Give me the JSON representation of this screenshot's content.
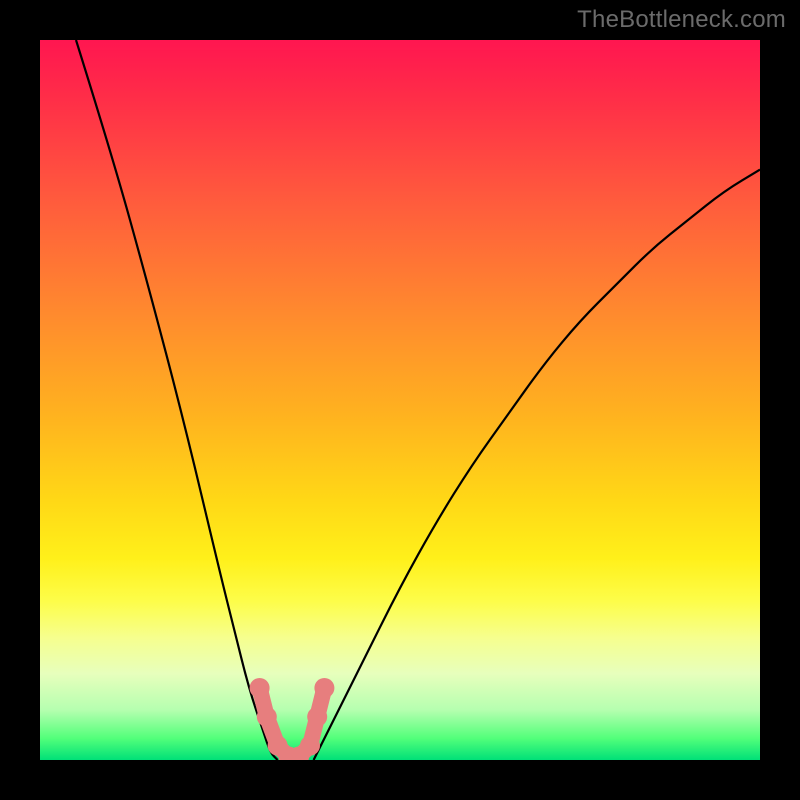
{
  "watermark": "TheBottleneck.com",
  "colors": {
    "black": "#000000",
    "dot": "#e77e7e"
  },
  "chart_data": {
    "type": "line",
    "title": "",
    "xlabel": "",
    "ylabel": "",
    "xlim": [
      0,
      100
    ],
    "ylim": [
      0,
      100
    ],
    "series": [
      {
        "name": "left-branch",
        "x": [
          5,
          10,
          15,
          20,
          25,
          27,
          29,
          31,
          32,
          33
        ],
        "y": [
          100,
          84,
          66,
          47,
          26,
          18,
          10,
          4,
          1,
          0
        ]
      },
      {
        "name": "right-branch",
        "x": [
          38,
          40,
          45,
          50,
          55,
          60,
          65,
          70,
          75,
          80,
          85,
          90,
          95,
          100
        ],
        "y": [
          0,
          4,
          14,
          24,
          33,
          41,
          48,
          55,
          61,
          66,
          71,
          75,
          79,
          82
        ]
      }
    ],
    "highlight_points": {
      "name": "minimum-region",
      "x": [
        30.5,
        31.5,
        33,
        34.5,
        36,
        37.5,
        38.5,
        39.5
      ],
      "y": [
        10,
        6,
        2,
        0.5,
        0.5,
        2,
        6,
        10
      ]
    }
  }
}
